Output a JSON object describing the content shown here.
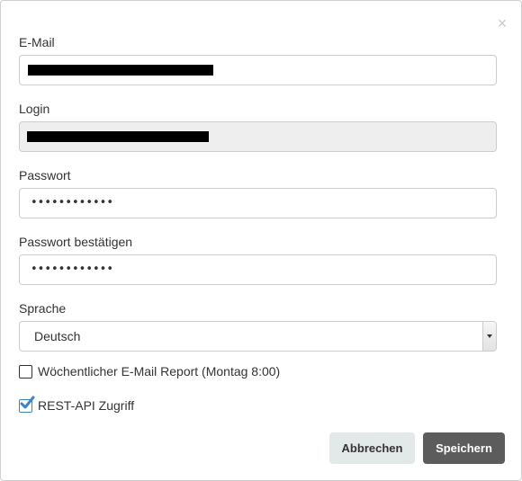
{
  "dialog": {
    "close_icon": "close-icon"
  },
  "fields": {
    "email": {
      "label": "E-Mail",
      "value_redacted": true
    },
    "login": {
      "label": "Login",
      "value_redacted": true,
      "disabled": true
    },
    "password": {
      "label": "Passwort",
      "value": "••••••••••••"
    },
    "password_confirm": {
      "label": "Passwort bestätigen",
      "value": "••••••••••••"
    },
    "language": {
      "label": "Sprache",
      "selected": "Deutsch"
    }
  },
  "options": {
    "weekly_report": {
      "label": "Wöchentlicher E-Mail Report (Montag 8:00)",
      "checked": false
    },
    "rest_api": {
      "label": "REST-API Zugriff",
      "checked": true
    }
  },
  "buttons": {
    "cancel_label": "Abbrechen",
    "save_label": "Speichern"
  },
  "colors": {
    "checkbox_accent": "#3b85c6",
    "save_button_bg": "#5c5c5c",
    "cancel_button_bg": "#e3e8e8",
    "disabled_input_bg": "#eeeeee"
  }
}
